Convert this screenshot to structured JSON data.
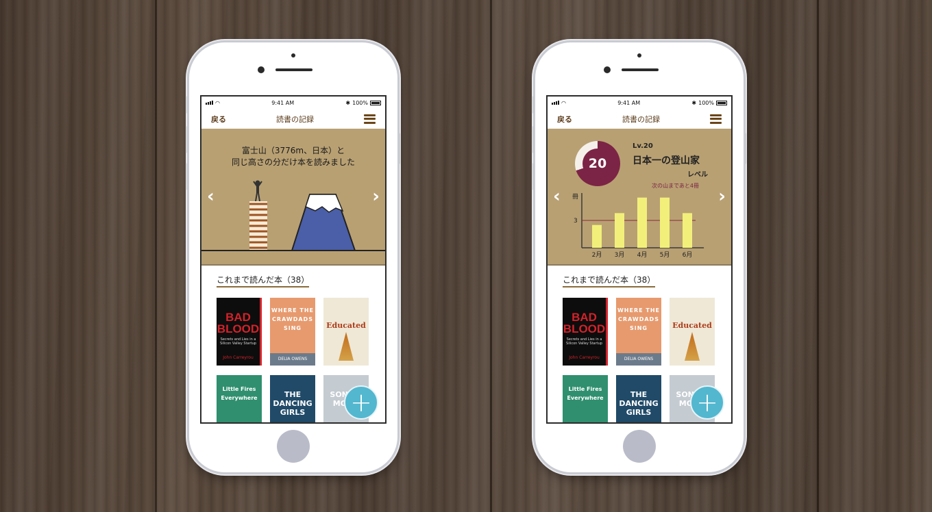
{
  "status_bar": {
    "time": "9:41 AM",
    "battery": "100%"
  },
  "navbar": {
    "back": "戻る",
    "title": "読書の記録"
  },
  "mountain_card": {
    "line1": "富士山（3776m、日本）と",
    "line2": "同じ高さの分だけ本を読みました"
  },
  "level_card": {
    "level_number": "20",
    "level_label": "Lv.20",
    "title": "日本一の登山家",
    "subtitle": "レベル",
    "next": "次の山まであと4冊",
    "progress_fraction": 0.7
  },
  "books_section": {
    "title": "これまで読んだ本（38）"
  },
  "books": [
    {
      "title": "BAD BLOOD",
      "subtitle": "Secrets and Lies in a Silicon Valley Startup",
      "author": "John Carreyrou"
    },
    {
      "title": "WHERE THE CRAWDADS SING",
      "author": "DELIA OWENS"
    },
    {
      "title": "Educated"
    },
    {
      "title": "Little Fires Everywhere"
    },
    {
      "title": "THE DANCING GIRLS"
    },
    {
      "title": "SON OF MOUN"
    }
  ],
  "chart_data": {
    "type": "bar",
    "categories": [
      "2月",
      "3月",
      "4月",
      "5月",
      "6月"
    ],
    "values": [
      2.5,
      3.8,
      5.5,
      5.5,
      3.8
    ],
    "ylabel": "冊",
    "reference_line": 3,
    "yticks": [
      3
    ],
    "colors": {
      "bar": "#f2f07a",
      "reference": "#8a2a3a",
      "axis": "#3a3a3a"
    }
  },
  "colors": {
    "accent": "#b8a073",
    "nav_text": "#5a3b1a",
    "fab": "#52b7cf",
    "level": "#7c2445",
    "mountain": "#4a5fa8"
  }
}
